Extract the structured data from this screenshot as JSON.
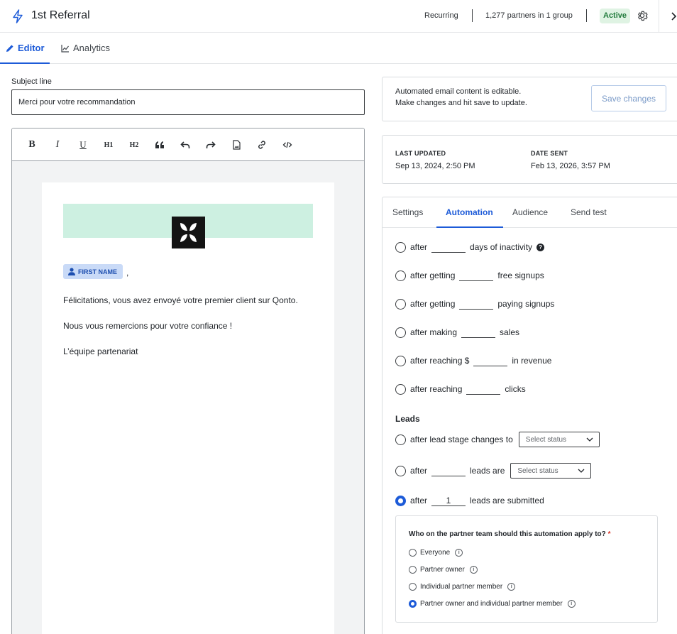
{
  "header": {
    "title": "1st Referral",
    "frequency": "Recurring",
    "partners": "1,277 partners in 1 group",
    "status": "Active"
  },
  "main_tabs": {
    "editor": "Editor",
    "analytics": "Analytics"
  },
  "subject": {
    "label": "Subject line",
    "value": "Merci pour votre recommandation"
  },
  "email_body": {
    "first_name_chip": "FIRST NAME",
    "comma": ",",
    "paragraphs": [
      "Félicitations, vous avez envoyé votre premier client sur Qonto.",
      "Nous vous remercions pour votre confiance !",
      "L’équipe partenariat"
    ]
  },
  "toolbar": {
    "h1": "H1",
    "h2": "H2"
  },
  "notice": {
    "line1": "Automated email content is editable.",
    "line2": "Make changes and hit save to update.",
    "save_label": "Save changes"
  },
  "meta": {
    "last_updated_label": "LAST UPDATED",
    "last_updated_value": "Sep 13, 2024, 2:50 PM",
    "date_sent_label": "DATE SENT",
    "date_sent_value": "Feb 13, 2026, 3:57 PM"
  },
  "settings_tabs": {
    "settings": "Settings",
    "automation": "Automation",
    "audience": "Audience",
    "send_test": "Send test"
  },
  "triggers": {
    "inactivity": {
      "pre": "after",
      "post": "days of inactivity",
      "help": "?"
    },
    "free_signups": {
      "pre": "after getting",
      "post": "free signups"
    },
    "paying_signups": {
      "pre": "after getting",
      "post": "paying signups"
    },
    "sales": {
      "pre": "after making",
      "post": "sales"
    },
    "revenue": {
      "pre": "after reaching $",
      "post": "in revenue"
    },
    "clicks": {
      "pre": "after reaching",
      "post": "clicks"
    }
  },
  "leads": {
    "heading": "Leads",
    "stage_change": {
      "pre": "after lead stage changes to",
      "placeholder": "Select status"
    },
    "leads_are": {
      "pre": "after",
      "mid": "leads are",
      "placeholder": "Select status"
    },
    "submitted": {
      "pre": "after",
      "value": "1",
      "post": "leads are submitted"
    }
  },
  "apply_to": {
    "question": "Who on the partner team should this automation apply to?",
    "required": "*",
    "options": [
      "Everyone",
      "Partner owner",
      "Individual partner member",
      "Partner owner and individual partner member"
    ],
    "info_glyph": "i"
  },
  "colors": {
    "accent": "#1d5bd8",
    "active_badge_bg": "#dff3e3",
    "active_badge_text": "#1f7a3a",
    "hero_bg": "#cdf0e1",
    "chip_bg": "#c9daf7"
  }
}
